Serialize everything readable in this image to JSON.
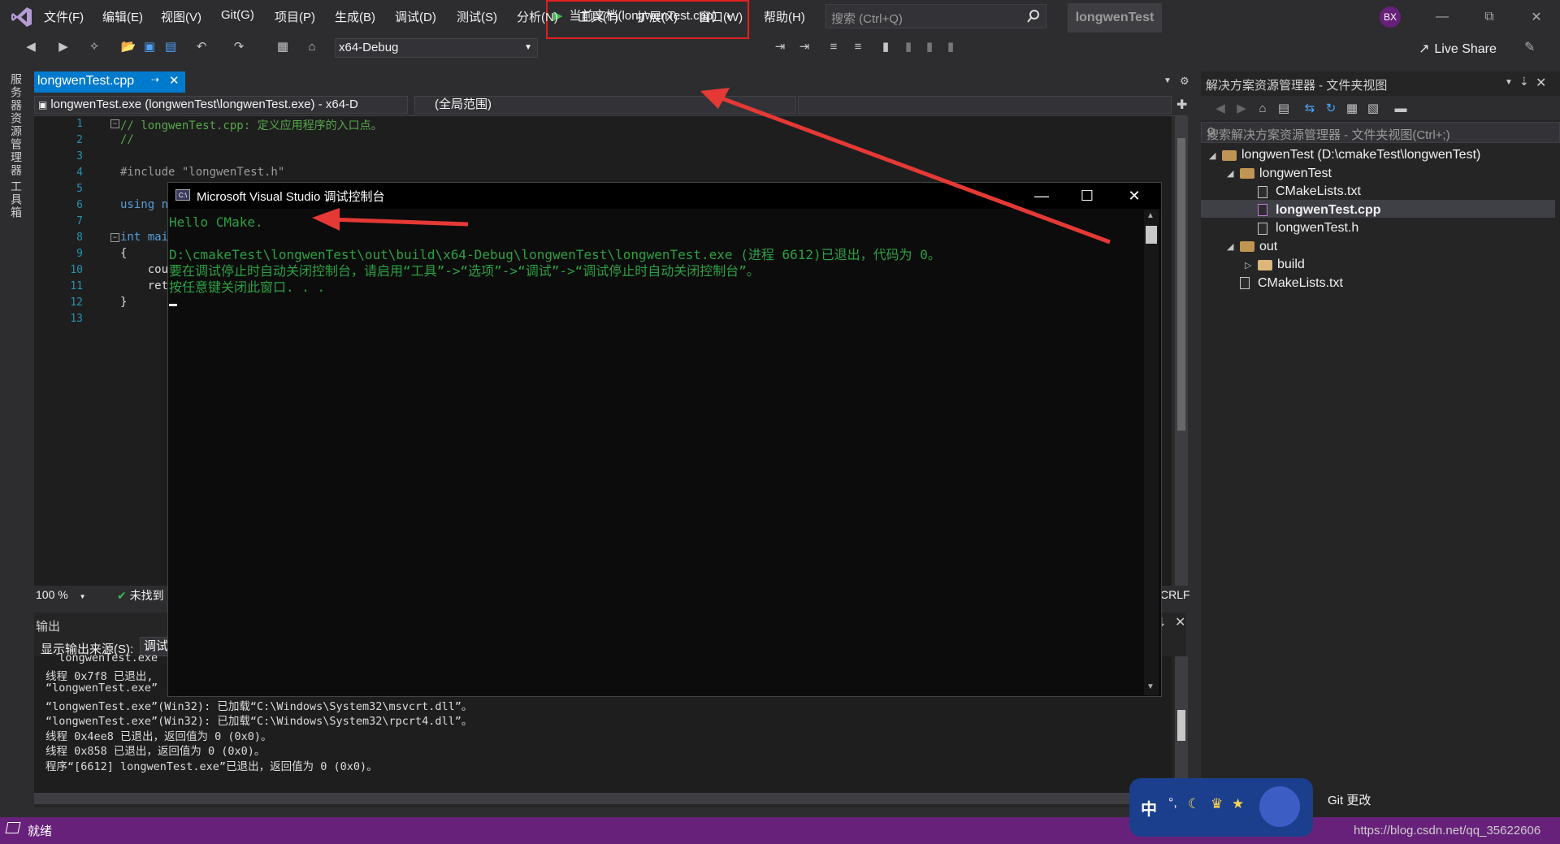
{
  "menu": [
    "文件(F)",
    "编辑(E)",
    "视图(V)",
    "Git(G)",
    "项目(P)",
    "生成(B)",
    "调试(D)",
    "测试(S)",
    "分析(N)",
    "工具(T)",
    "扩展(X)",
    "窗口(W)",
    "帮助(H)"
  ],
  "search": {
    "placeholder": "搜索 (Ctrl+Q)"
  },
  "project_badge": "longwenTest",
  "user_initials": "BX",
  "toolbar": {
    "config": "x64-Debug",
    "run_target": "当前文档(longwenTest.cpp)",
    "live_share": "Live Share"
  },
  "left_strip": [
    "服务器资源管理器",
    "工具箱"
  ],
  "editor": {
    "tab_label": "longwenTest.cpp",
    "nav_target": "longwenTest.exe (longwenTest\\longwenTest.exe) - x64-D",
    "nav_scope": "(全局范围)",
    "line_numbers": [
      "1",
      "2",
      "3",
      "4",
      "5",
      "6",
      "7",
      "8",
      "9",
      "10",
      "11",
      "12",
      "13"
    ],
    "code_lines": [
      "// longwenTest.cpp: 定义应用程序的入口点。",
      "//",
      "",
      "#include \"longwenTest.h\"",
      "",
      "using n",
      "",
      "int mai",
      "{",
      "    cou",
      "    ret",
      "}",
      ""
    ],
    "zoom": "100 %",
    "issues": "未找到",
    "line_ending": "CRLF"
  },
  "output": {
    "title": "输出",
    "source_label": "显示输出来源(S):",
    "source_value": "调试",
    "lines": [
      "  longwenTest.exe",
      "线程 0x7f8 已退出,",
      "“longwenTest.exe”",
      "“longwenTest.exe”(Win32): 已加载“C:\\Windows\\System32\\msvcrt.dll”。",
      "“longwenTest.exe”(Win32): 已加载“C:\\Windows\\System32\\rpcrt4.dll”。",
      "线程 0x4ee8 已退出，返回值为 0 (0x0)。",
      "线程 0x858 已退出，返回值为 0 (0x0)。",
      "程序“[6612] longwenTest.exe”已退出，返回值为 0 (0x0)。"
    ]
  },
  "solution_explorer": {
    "title": "解决方案资源管理器 - 文件夹视图",
    "search_placeholder": "搜索解决方案资源管理器 - 文件夹视图(Ctrl+;)",
    "items": [
      {
        "label": "longwenTest (D:\\cmakeTest\\longwenTest)",
        "kind": "folder-open"
      },
      {
        "label": "longwenTest",
        "kind": "folder-open"
      },
      {
        "label": "CMakeLists.txt",
        "kind": "file"
      },
      {
        "label": "longwenTest.cpp",
        "kind": "file",
        "selected": true
      },
      {
        "label": "longwenTest.h",
        "kind": "file"
      },
      {
        "label": "out",
        "kind": "folder-open"
      },
      {
        "label": "build",
        "kind": "folder"
      },
      {
        "label": "CMakeLists.txt",
        "kind": "file"
      }
    ],
    "git_changes": "Git 更改"
  },
  "console": {
    "title": "Microsoft Visual Studio 调试控制台",
    "icon_text": "C:\\",
    "lines": [
      "Hello CMake.",
      "",
      "D:\\cmakeTest\\longwenTest\\out\\build\\x64-Debug\\longwenTest\\longwenTest.exe (进程 6612)已退出，代码为 0。",
      "要在调试停止时自动关闭控制台，请启用“工具”->“选项”->“调试”->“调试停止时自动关闭控制台”。",
      "按任意键关闭此窗口. . ."
    ]
  },
  "status": {
    "ready": "就绪",
    "url": "https://blog.csdn.net/qq_35622606"
  },
  "ime": {
    "label": "中"
  },
  "colors": {
    "accent": "#007acc",
    "statusbar": "#68217a",
    "console_text": "#2ea043",
    "highlight_box": "#e02020"
  }
}
